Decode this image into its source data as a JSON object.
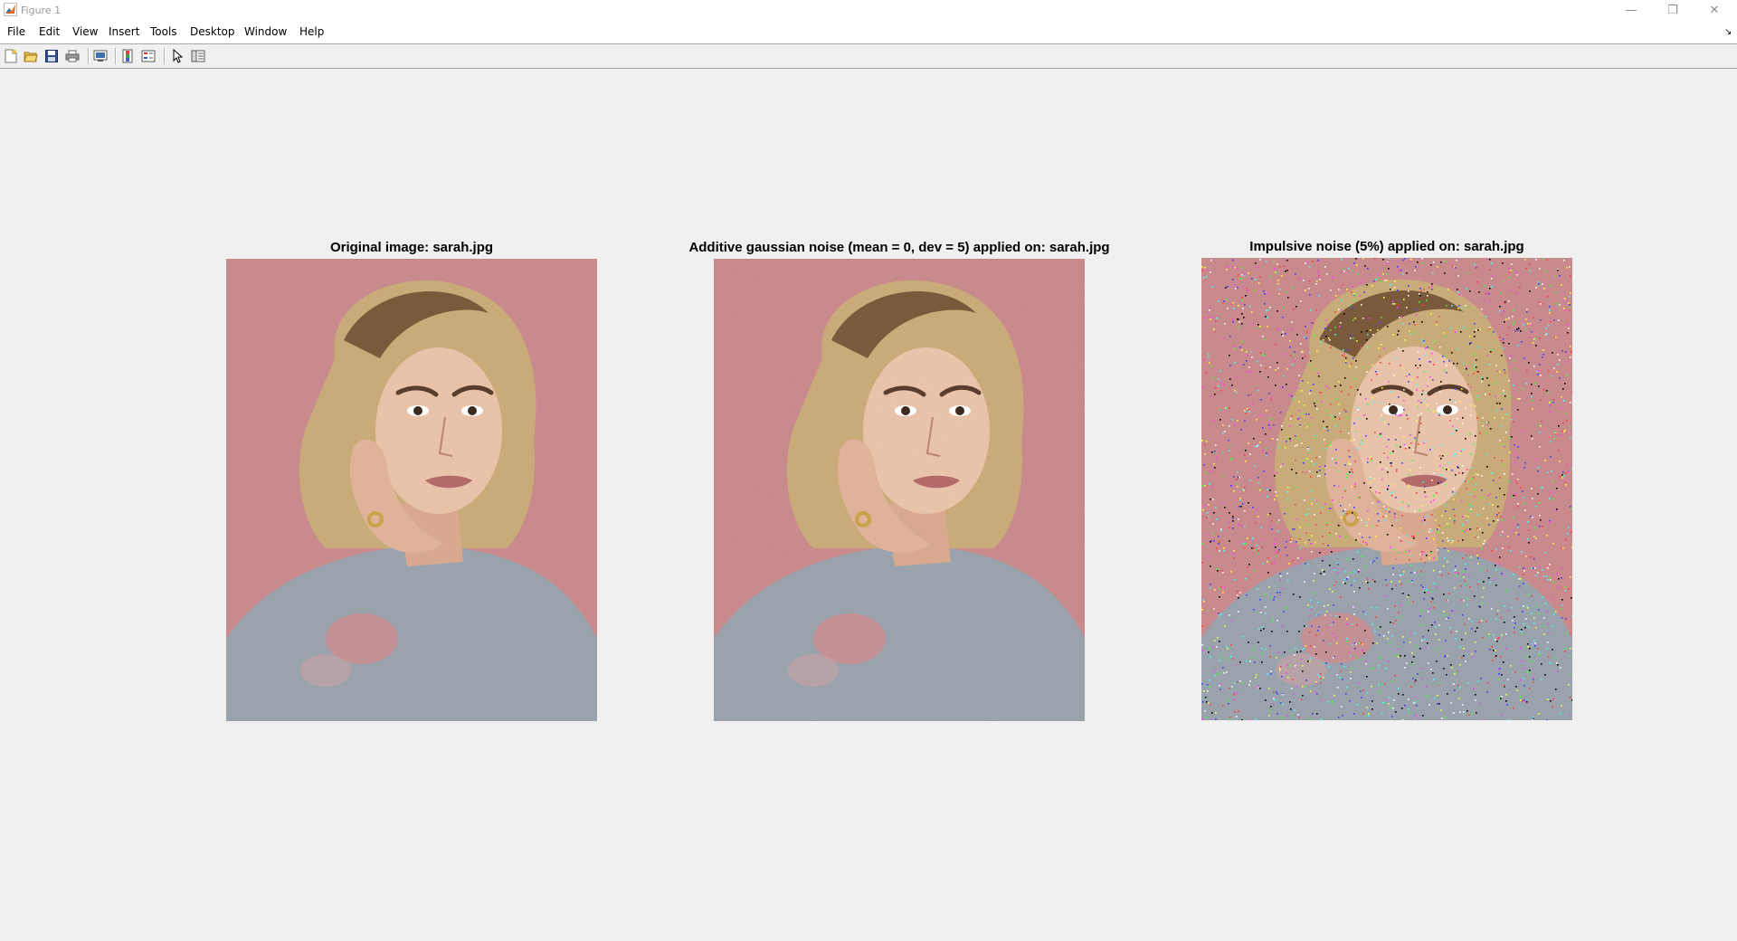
{
  "window": {
    "title": "Figure 1",
    "controls": {
      "minimize": "—",
      "maximize": "❐",
      "close": "✕"
    }
  },
  "menubar": {
    "items": [
      "File",
      "Edit",
      "View",
      "Insert",
      "Tools",
      "Desktop",
      "Window",
      "Help"
    ]
  },
  "toolbar": {
    "buttons": [
      "new-figure-icon",
      "open-file-icon",
      "save-icon",
      "print-icon",
      "link-plot-icon",
      "insert-colorbar-icon",
      "insert-legend-icon",
      "edit-plot-icon",
      "property-inspector-icon"
    ]
  },
  "axes": [
    {
      "title": "Original image: sarah.jpg",
      "noise": "none"
    },
    {
      "title": "Additive gaussian noise (mean = 0, dev = 5) applied on: sarah.jpg",
      "noise": "gaussian"
    },
    {
      "title": "Impulsive noise (5%) applied on: sarah.jpg",
      "noise": "impulse"
    }
  ],
  "colors": {
    "figure_bg": "#f0f0f0",
    "photo_bg": "#c88a8c",
    "hair": "#c9ab7a",
    "skin": "#e8c3aa",
    "shirt": "#9aa3ac"
  }
}
